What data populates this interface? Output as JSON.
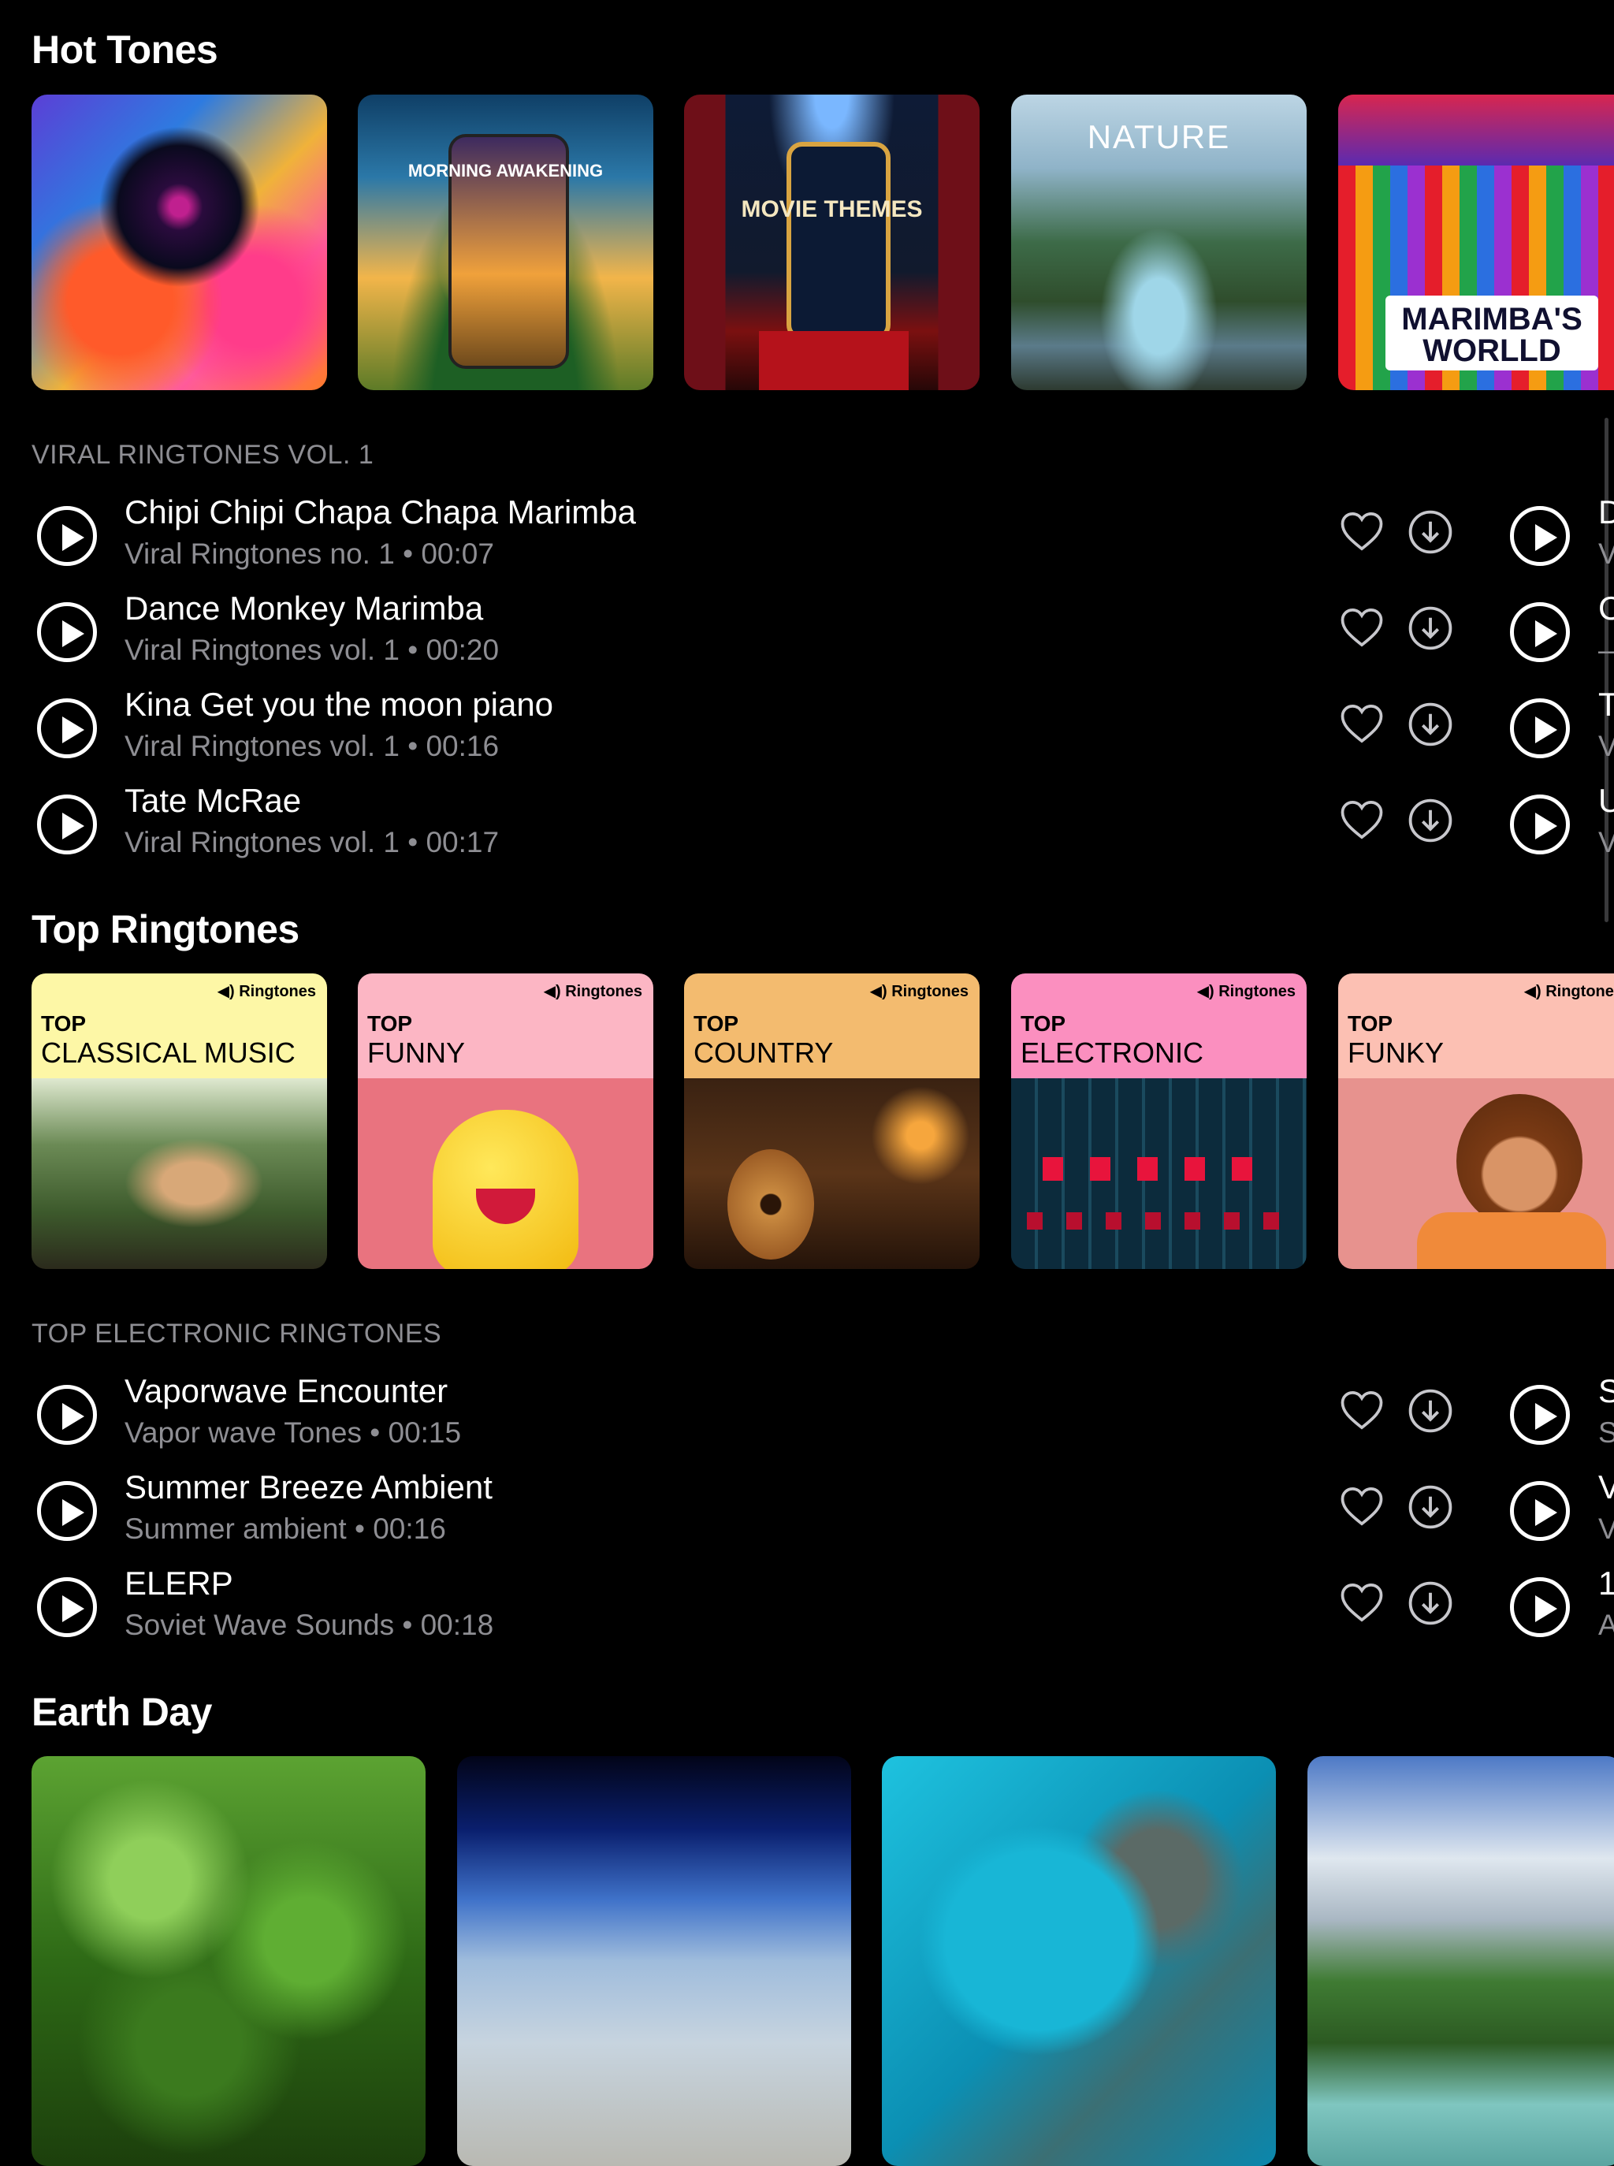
{
  "hot_tones": {
    "title": "Hot Tones",
    "tiles": [
      {
        "caption": ""
      },
      {
        "caption": "MORNING AWAKENING"
      },
      {
        "caption": "MOVIE THEMES"
      },
      {
        "caption": "NATURE"
      },
      {
        "caption": "MARIMBA'S WORLLD"
      }
    ]
  },
  "viral": {
    "label": "VIRAL RINGTONES VOL. 1",
    "songs": [
      {
        "title": "Chipi Chipi Chapa Chapa Marimba",
        "subtitle": "Viral Ringtones no. 1 • 00:07",
        "peek_title": "D",
        "peek_sub": "V"
      },
      {
        "title": "Dance Monkey Marimba",
        "subtitle": "Viral Ringtones vol. 1 • 00:20",
        "peek_title": "C",
        "peek_sub": "–"
      },
      {
        "title": "Kina Get you the moon piano",
        "subtitle": "Viral Ringtones vol. 1 • 00:16",
        "peek_title": "T",
        "peek_sub": "V"
      },
      {
        "title": "Tate McRae",
        "subtitle": "Viral Ringtones vol. 1 • 00:17",
        "peek_title": "U",
        "peek_sub": "V"
      }
    ]
  },
  "top_ringtones": {
    "title": "Top Ringtones",
    "brand": "Ringtones",
    "cards": [
      {
        "top": "TOP",
        "genre": "CLASSICAL MUSIC",
        "color": "#fdf7a6"
      },
      {
        "top": "TOP",
        "genre": "FUNNY",
        "color": "#fcb6c4"
      },
      {
        "top": "TOP",
        "genre": "COUNTRY",
        "color": "#f3bb6f"
      },
      {
        "top": "TOP",
        "genre": "ELECTRONIC",
        "color": "#fb8fbf"
      },
      {
        "top": "TOP",
        "genre": "FUNKY",
        "color": "#fcc0b3"
      }
    ]
  },
  "electronic": {
    "label": "TOP ELECTRONIC RINGTONES",
    "songs": [
      {
        "title": "Vaporwave Encounter",
        "subtitle": "Vapor wave Tones • 00:15",
        "peek_title": "S",
        "peek_sub": "S"
      },
      {
        "title": "Summer Breeze Ambient",
        "subtitle": "Summer ambient • 00:16",
        "peek_title": "V",
        "peek_sub": "V"
      },
      {
        "title": "ELERP",
        "subtitle": "Soviet Wave Sounds • 00:18",
        "peek_title": "1",
        "peek_sub": "A"
      }
    ]
  },
  "earth_day": {
    "title": "Earth Day"
  },
  "icons": {
    "play": "play-icon",
    "heart": "heart-icon",
    "download": "download-icon",
    "speaker": "speaker-icon"
  }
}
